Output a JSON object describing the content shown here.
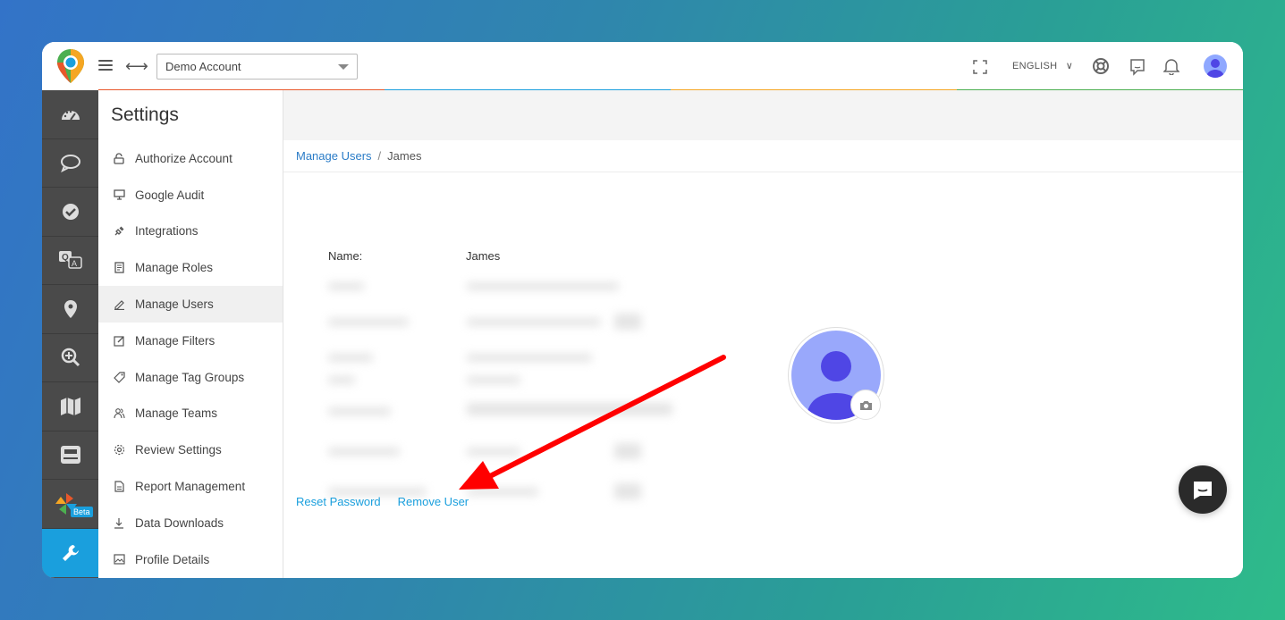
{
  "topbar": {
    "account": "Demo Account",
    "language": "ENGLISH"
  },
  "colors": {
    "accent": "#1a9fdd",
    "rail": "#4a4a4a",
    "link": "#2a7cc7",
    "line": [
      "#e8572a",
      "#1a9fdd",
      "#f5a623",
      "#4caf50"
    ],
    "arrow": "#ff0000"
  },
  "rail": {
    "icons": [
      "dashboard-icon",
      "chat-icon",
      "check-circle-icon",
      "qa-icon",
      "location-pin-icon",
      "zoom-in-icon",
      "map-icon",
      "inbox-icon",
      "pinwheel-icon",
      "wrench-icon"
    ],
    "beta_label": "Beta"
  },
  "menu": {
    "title": "Settings",
    "items": [
      {
        "label": "Authorize Account",
        "icon": "unlock-icon"
      },
      {
        "label": "Google Audit",
        "icon": "monitor-icon"
      },
      {
        "label": "Integrations",
        "icon": "plug-icon"
      },
      {
        "label": "Manage Roles",
        "icon": "document-icon"
      },
      {
        "label": "Manage Users",
        "icon": "pencil-icon"
      },
      {
        "label": "Manage Filters",
        "icon": "edit-icon"
      },
      {
        "label": "Manage Tag Groups",
        "icon": "tag-icon"
      },
      {
        "label": "Manage Teams",
        "icon": "team-icon"
      },
      {
        "label": "Review Settings",
        "icon": "gear-icon"
      },
      {
        "label": "Report Management",
        "icon": "report-icon"
      },
      {
        "label": "Data Downloads",
        "icon": "download-icon"
      },
      {
        "label": "Profile Details",
        "icon": "image-icon"
      }
    ]
  },
  "breadcrumb": {
    "parent": "Manage Users",
    "separator": "/",
    "current": "James"
  },
  "user": {
    "name_label": "Name:",
    "name_value": "James"
  },
  "actions": {
    "reset": "Reset Password",
    "remove": "Remove User"
  }
}
